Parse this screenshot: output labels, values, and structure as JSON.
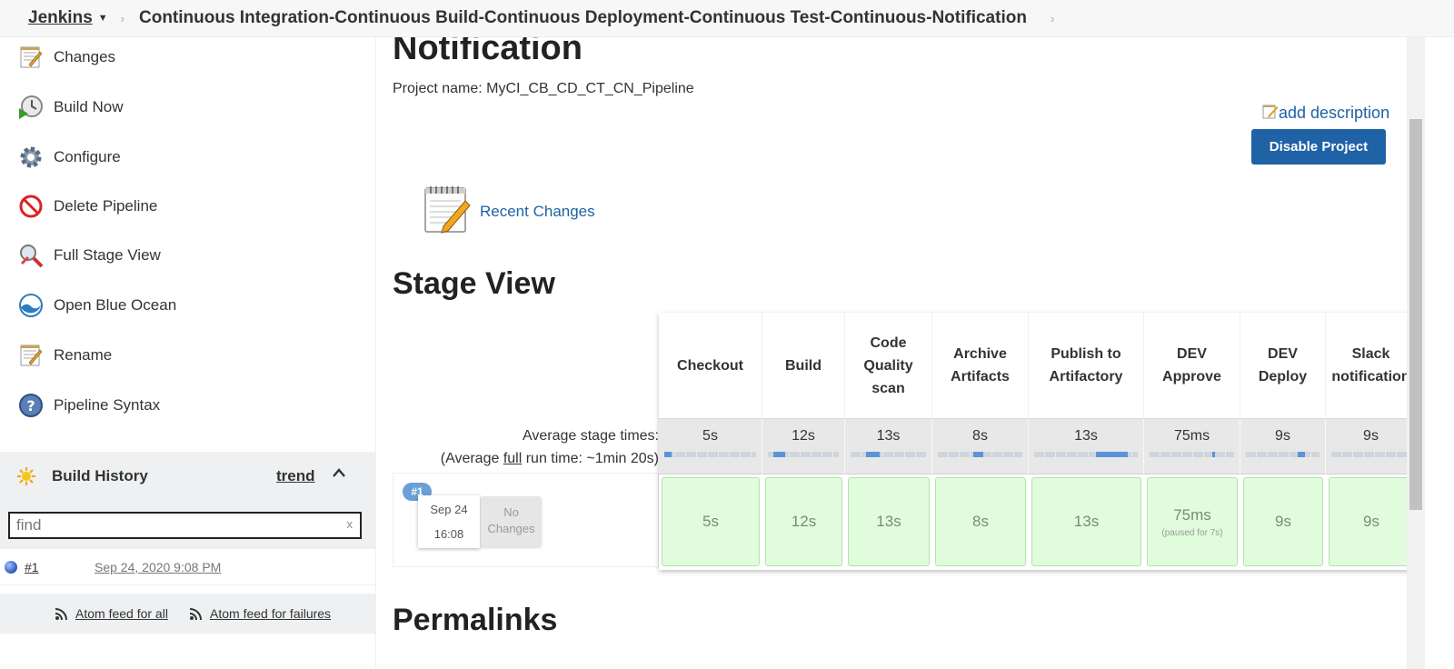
{
  "breadcrumb": {
    "home": "Jenkins",
    "job": "Continuous Integration-Continuous Build-Continuous Deployment-Continuous Test-Continuous-Notification"
  },
  "sidebar": {
    "items": [
      {
        "label": "Changes",
        "icon": "notepad-icon"
      },
      {
        "label": "Build Now",
        "icon": "clock-play-icon"
      },
      {
        "label": "Configure",
        "icon": "gear-icon"
      },
      {
        "label": "Delete Pipeline",
        "icon": "no-entry-icon"
      },
      {
        "label": "Full Stage View",
        "icon": "magnifier-icon"
      },
      {
        "label": "Open Blue Ocean",
        "icon": "blue-ocean-icon"
      },
      {
        "label": "Rename",
        "icon": "notepad-icon"
      },
      {
        "label": "Pipeline Syntax",
        "icon": "help-icon"
      }
    ]
  },
  "build_history": {
    "title": "Build History",
    "trend": "trend",
    "find_value": "find",
    "find_clear": "x",
    "builds": [
      {
        "number": "#1",
        "date": "Sep 24, 2020 9:08 PM"
      }
    ],
    "feed_all": "Atom feed for all",
    "feed_failures": "Atom feed for failures"
  },
  "main": {
    "title": "Notification",
    "project_name": "Project name: MyCI_CB_CD_CT_CN_Pipeline",
    "add_description": "add description",
    "disable_button": "Disable Project",
    "recent_changes": "Recent Changes",
    "stage_view_title": "Stage View",
    "permalinks_title": "Permalinks"
  },
  "stage_view": {
    "avg_label": "Average stage times:",
    "avg_full_prefix": "(Average ",
    "avg_full_link": "full",
    "avg_full_suffix": " run time: ~1min 20s)",
    "build_badge": "#1",
    "build_date": "Sep 24",
    "build_time": "16:08",
    "no_changes_line1": "No",
    "no_changes_line2": "Changes",
    "stages": [
      {
        "name": [
          "Checkout"
        ],
        "avg": "5s",
        "cell": "5s",
        "note": ""
      },
      {
        "name": [
          "Build"
        ],
        "avg": "12s",
        "cell": "12s",
        "note": ""
      },
      {
        "name": [
          "Code",
          "Quality",
          "scan"
        ],
        "avg": "13s",
        "cell": "13s",
        "note": ""
      },
      {
        "name": [
          "Archive",
          "Artifacts"
        ],
        "avg": "8s",
        "cell": "8s",
        "note": ""
      },
      {
        "name": [
          "Publish to",
          "Artifactory"
        ],
        "avg": "13s",
        "cell": "13s",
        "note": ""
      },
      {
        "name": [
          "DEV",
          "Approve"
        ],
        "avg": "75ms",
        "cell": "75ms",
        "note": "(paused for 7s)"
      },
      {
        "name": [
          "DEV",
          "Deploy"
        ],
        "avg": "9s",
        "cell": "9s",
        "note": ""
      },
      {
        "name": [
          "Slack",
          "notification"
        ],
        "avg": "9s",
        "cell": "9s",
        "note": ""
      }
    ]
  },
  "colors": {
    "link": "#1f62a6",
    "success_cell": "#e0fcdc",
    "progress": "#5b93d9"
  }
}
